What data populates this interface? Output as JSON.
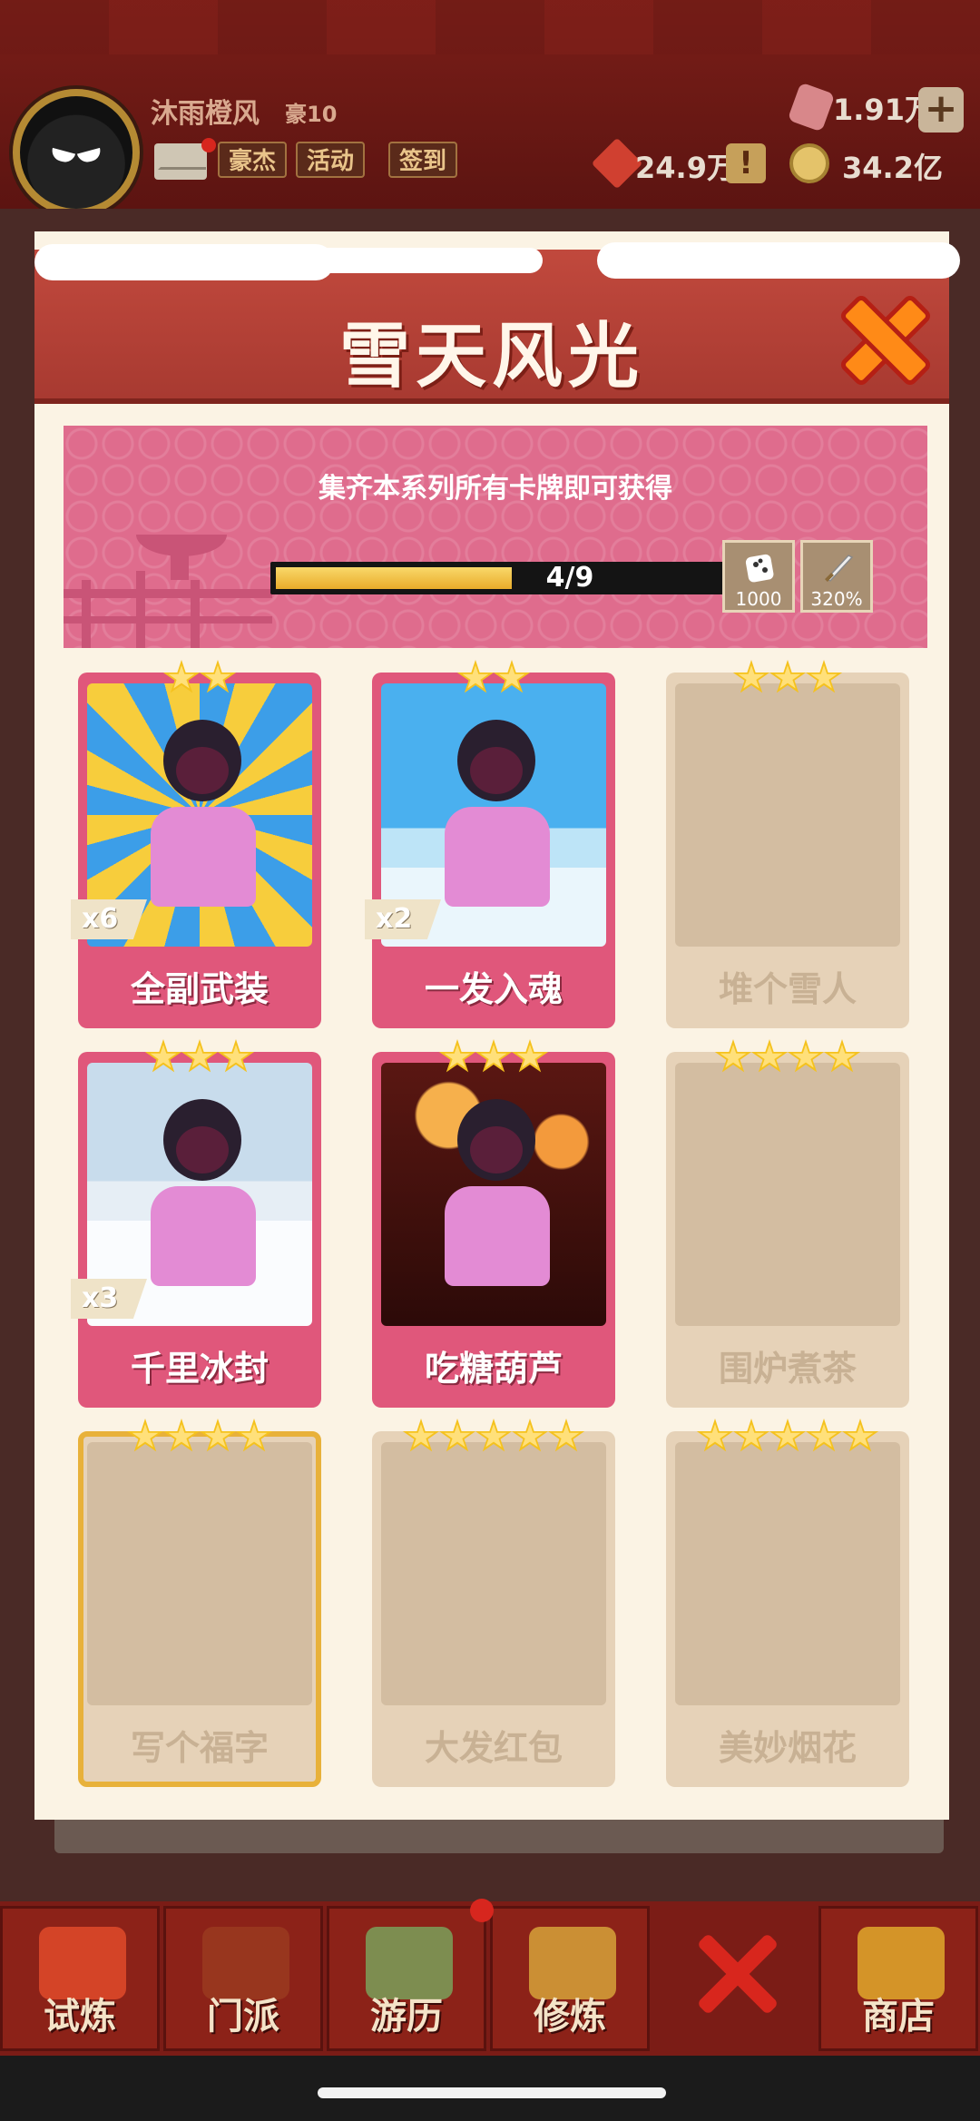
{
  "hud": {
    "player_name": "沐雨橙风",
    "player_rank": "豪10",
    "buttons": {
      "hero": "豪杰",
      "activity": "活动",
      "checkin": "签到"
    },
    "resources": {
      "gems": "1.91万",
      "tickets": "24.9万",
      "coins": "34.2亿"
    },
    "plus": "+",
    "exclaim": "!"
  },
  "modal": {
    "title": "雪天风光",
    "banner": {
      "text": "集齐本系列所有卡牌即可获得",
      "progress_text": "4/9",
      "progress_fraction": 0.444,
      "rewards": [
        {
          "icon": "dice-icon",
          "value": "1000"
        },
        {
          "icon": "sword-icon",
          "value": "320%"
        }
      ]
    },
    "cards": [
      {
        "name": "全副武装",
        "stars": 2,
        "owned": true,
        "count": "x6",
        "art": "sunburst"
      },
      {
        "name": "一发入魂",
        "stars": 2,
        "owned": true,
        "count": "x2",
        "art": "skate"
      },
      {
        "name": "堆个雪人",
        "stars": 3,
        "owned": false,
        "count": "",
        "art": ""
      },
      {
        "name": "千里冰封",
        "stars": 3,
        "owned": true,
        "count": "x3",
        "art": "snow"
      },
      {
        "name": "吃糖葫芦",
        "stars": 3,
        "owned": true,
        "count": "",
        "art": "lantern"
      },
      {
        "name": "围炉煮茶",
        "stars": 4,
        "owned": false,
        "count": "",
        "art": ""
      },
      {
        "name": "写个福字",
        "stars": 4,
        "owned": false,
        "count": "",
        "art": "",
        "gold_frame": true
      },
      {
        "name": "大发红包",
        "stars": 5,
        "owned": false,
        "count": "",
        "art": ""
      },
      {
        "name": "美妙烟花",
        "stars": 5,
        "owned": false,
        "count": "",
        "art": ""
      }
    ]
  },
  "bottom_nav": {
    "items": [
      {
        "label": "试炼"
      },
      {
        "label": "门派"
      },
      {
        "label": "游历"
      },
      {
        "label": "修炼"
      },
      {
        "label": "商店"
      }
    ]
  },
  "colors": {
    "header_red": "#b04036",
    "card_pink": "#e0577b",
    "locked_card": "#e6d2b8",
    "star_gold": "#f5c21e",
    "close_orange": "#ff8a17"
  }
}
